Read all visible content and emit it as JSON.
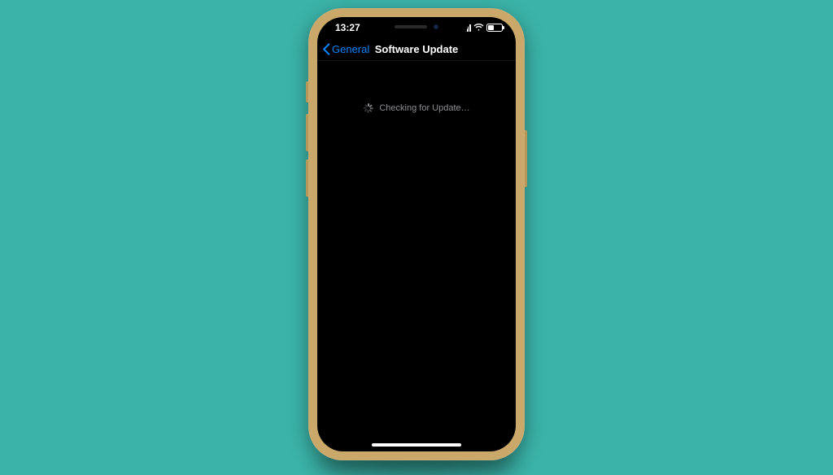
{
  "status_bar": {
    "time": "13:27"
  },
  "nav": {
    "back_label": "General",
    "title": "Software Update"
  },
  "content": {
    "loading_text": "Checking for Update…"
  }
}
